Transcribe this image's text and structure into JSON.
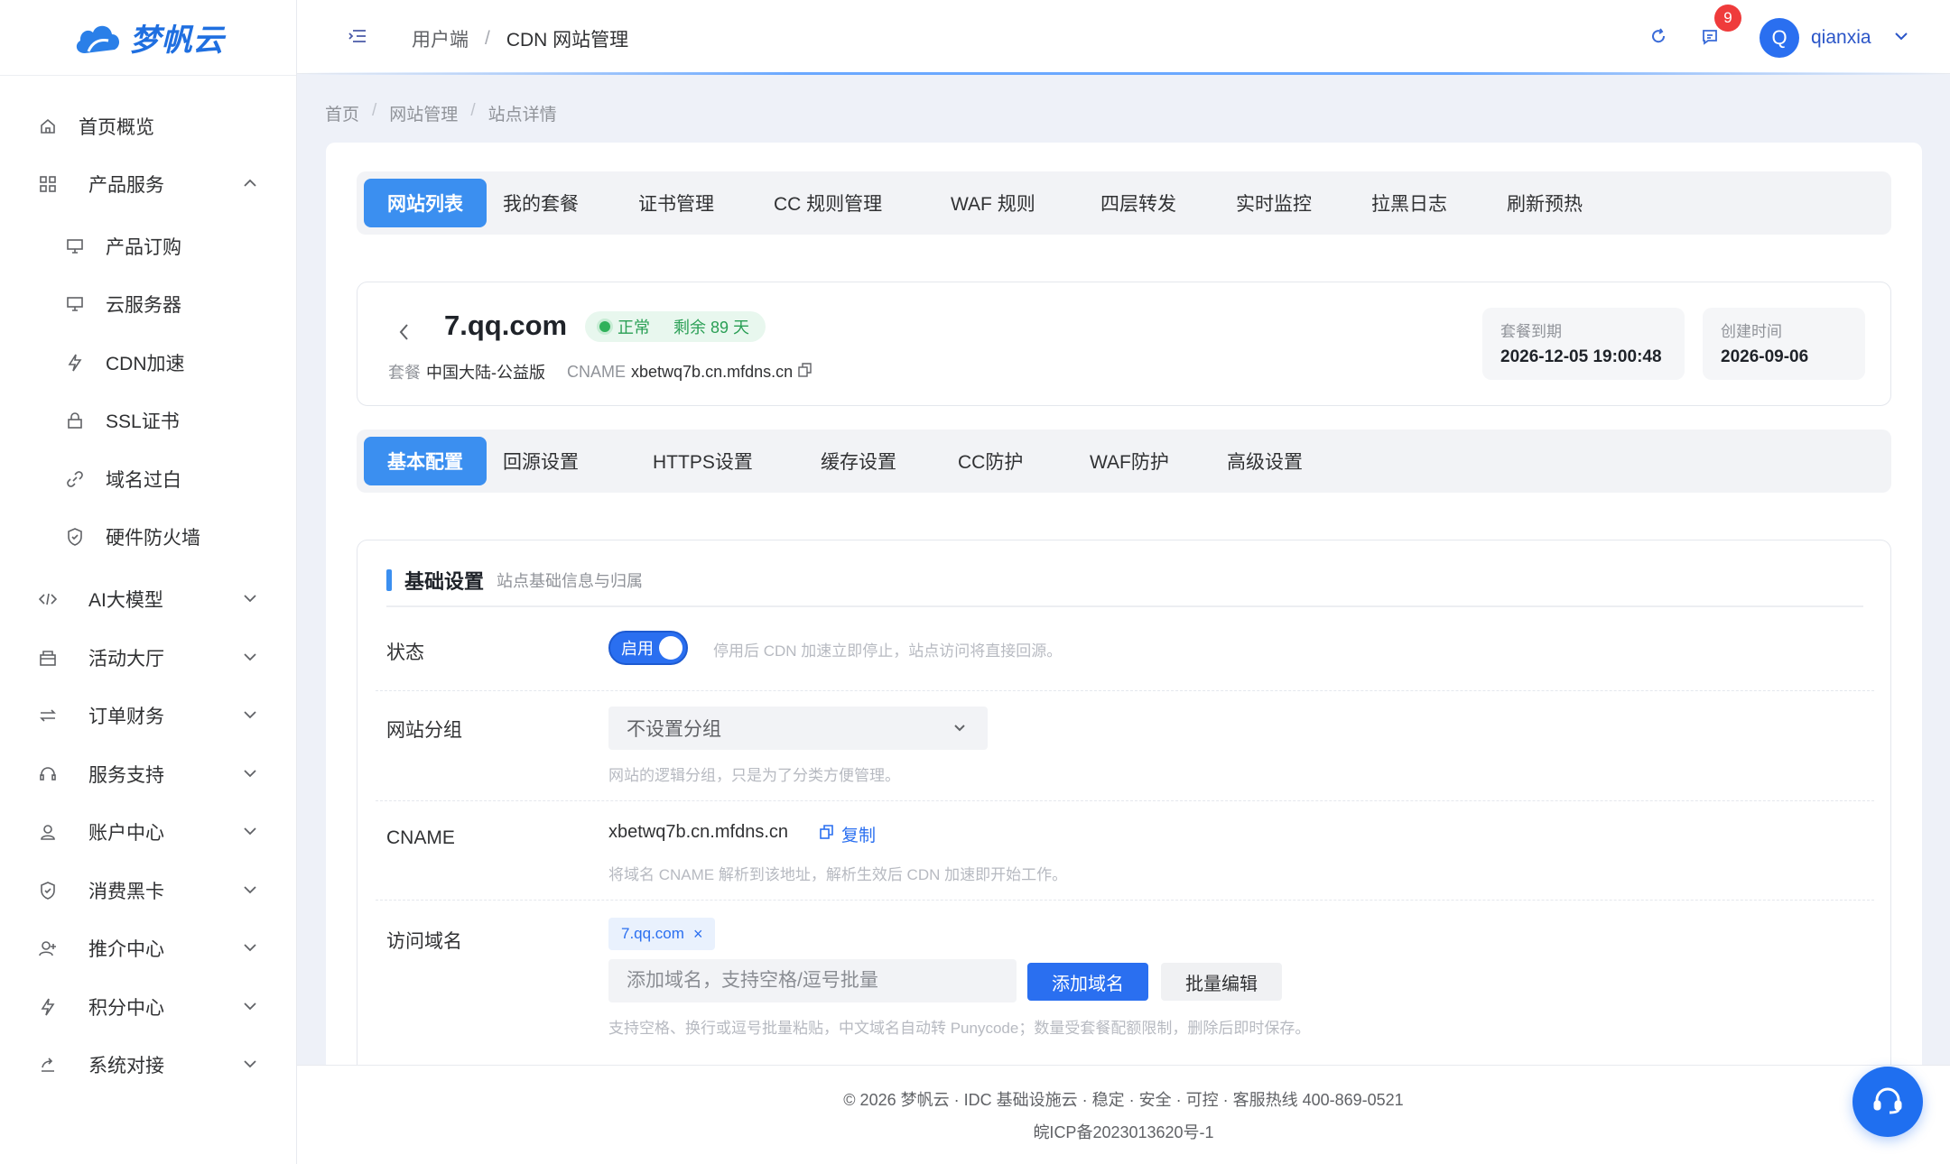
{
  "brand": {
    "name": "梦帆云"
  },
  "sidebar": {
    "items": [
      {
        "label": "首页概览",
        "icon": "home-icon"
      },
      {
        "label": "产品服务",
        "icon": "grid-icon",
        "expanded": true
      },
      {
        "label": "产品订购",
        "icon": "monitor-icon"
      },
      {
        "label": "云服务器",
        "icon": "monitor-icon"
      },
      {
        "label": "CDN加速",
        "icon": "bolt-icon"
      },
      {
        "label": "SSL证书",
        "icon": "lock-icon"
      },
      {
        "label": "域名过白",
        "icon": "link-icon"
      },
      {
        "label": "硬件防火墙",
        "icon": "shield-icon"
      },
      {
        "label": "AI大模型",
        "icon": "code-icon"
      },
      {
        "label": "活动大厅",
        "icon": "gift-icon"
      },
      {
        "label": "订单财务",
        "icon": "swap-icon"
      },
      {
        "label": "服务支持",
        "icon": "headset-icon"
      },
      {
        "label": "账户中心",
        "icon": "user-icon"
      },
      {
        "label": "消费黑卡",
        "icon": "shield-check-icon"
      },
      {
        "label": "推介中心",
        "icon": "user-plus-icon"
      },
      {
        "label": "积分中心",
        "icon": "bolt-icon"
      },
      {
        "label": "系统对接",
        "icon": "share-icon"
      }
    ]
  },
  "header": {
    "breadcrumb": [
      "用户端",
      "CDN 网站管理"
    ],
    "separator": "/",
    "notification_count": "9",
    "avatar_letter": "Q",
    "username": "qianxia"
  },
  "page_breadcrumb": [
    "首页",
    "网站管理",
    "站点详情"
  ],
  "page_breadcrumb_sep": "/",
  "top_tabs": [
    "网站列表",
    "我的套餐",
    "证书管理",
    "CC 规则管理",
    "WAF 规则",
    "四层转发",
    "实时监控",
    "拉黑日志",
    "刷新预热"
  ],
  "site": {
    "domain": "7.qq.com",
    "status": "正常",
    "remaining": "剩余 89 天",
    "package_key": "套餐",
    "package_val": "中国大陆-公益版",
    "cname_key": "CNAME",
    "cname_val": "xbetwq7b.cn.mfdns.cn",
    "expire_key": "套餐到期",
    "expire_val": "2026-12-05 19:00:48",
    "created_key": "创建时间",
    "created_val": "2026-09-06"
  },
  "config_tabs": [
    "基本配置",
    "回源设置",
    "HTTPS设置",
    "缓存设置",
    "CC防护",
    "WAF防护",
    "高级设置"
  ],
  "basic": {
    "title": "基础设置",
    "subtitle": "站点基础信息与归属",
    "status_label": "状态",
    "switch_text": "启用",
    "status_hint": "停用后 CDN 加速立即停止，站点访问将直接回源。",
    "group_label": "网站分组",
    "group_value": "不设置分组",
    "group_hint": "网站的逻辑分组，只是为了分类方便管理。",
    "cname_label": "CNAME",
    "cname_value": "xbetwq7b.cn.mfdns.cn",
    "copy_text": "复制",
    "cname_hint": "将域名 CNAME 解析到该地址，解析生效后 CDN 加速即开始工作。",
    "domain_label": "访问域名",
    "domain_tag": "7.qq.com",
    "domain_tag_close": "×",
    "add_placeholder": "添加域名，支持空格/逗号批量",
    "add_button": "添加域名",
    "batch_button": "批量编辑",
    "domain_hint": "支持空格、换行或逗号批量粘贴，中文域名自动转 Punycode；数量受套餐配额限制，删除后即时保存。"
  },
  "footer": {
    "line1": "© 2026 梦帆云 · IDC 基础设施云 · 稳定 · 安全 · 可控 · 客服热线 400-869-0521",
    "line2": "皖ICP备2023013620号-1"
  },
  "colors": {
    "primary": "#2a6ff0",
    "tab_active": "#3b8ff0",
    "success": "#2fb15a",
    "badge": "#ef3b3b"
  }
}
